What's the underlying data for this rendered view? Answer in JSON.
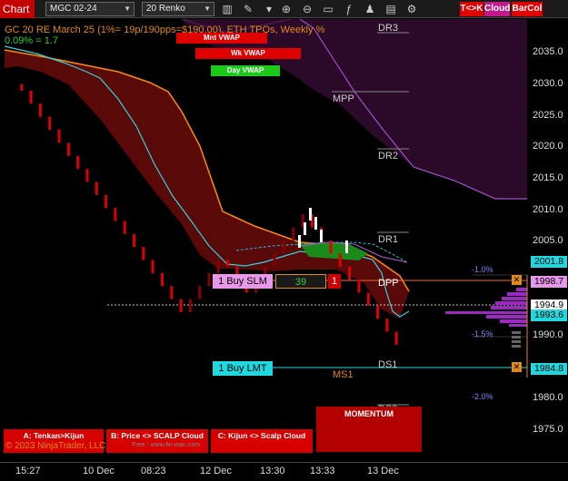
{
  "toolbar": {
    "title": "Chart",
    "instrument": "MGC 02-24",
    "bar_type": "20 Renko",
    "btn_tk": "T<>K",
    "btn_cloud": "Cloud",
    "btn_barcol": "BarCol",
    "colors": {
      "tk": "#e00000",
      "cloud": "#c2188a",
      "barcol": "#e00000"
    },
    "icons": [
      "bar-style-icon",
      "drawing-tool-icon",
      "zoom-in-icon",
      "zoom-out-icon",
      "data-box-icon",
      "indicators-icon",
      "strategies-icon",
      "properties-icon",
      "chart-trader-icon"
    ]
  },
  "chart": {
    "title": "GC 20 RE March 25 (1%= 19p/190pps=$190.00), ETH TPOs, Weekly %",
    "pct_readout": "0.09% = 1.7",
    "vwap_buttons": [
      {
        "label": "Mnt VWAP",
        "color": "#e00000"
      },
      {
        "label": "Wk VWAP",
        "color": "#e00000"
      },
      {
        "label": "Day VWAP",
        "color": "#1cc81c"
      }
    ],
    "levels": {
      "dr3": "DR3",
      "mpp": "MPP",
      "dr2": "DR2",
      "dr1": "DR1",
      "dpp": "DPP",
      "ds1": "DS1",
      "ms1": "MS1",
      "ds2": "DS2"
    },
    "pct_labels": [
      "-1.0%",
      "-1.5%",
      "-2.0%"
    ],
    "orders": {
      "buy_slm": {
        "label": "1 Buy SLM",
        "price": "1998.7",
        "qty": "39",
        "contracts": "1"
      },
      "buy_lmt": {
        "label": "1 Buy LMT",
        "price": "1984.8"
      }
    },
    "price_tags": {
      "level_2001": "2001.8",
      "last": "1994.9",
      "current": "1993.6"
    },
    "y_axis_labels": [
      "2035.0",
      "2030.0",
      "2025.0",
      "2020.0",
      "2015.0",
      "2010.0",
      "2005.0",
      "1990.0",
      "1980.0",
      "1975.0"
    ],
    "bottom_buttons": [
      {
        "label": "A: Tenkan>Kijun"
      },
      {
        "label": "B: Price <> SCALP Cloud"
      },
      {
        "label": "C: Kijun <> Scalp Cloud"
      }
    ],
    "momentum_label": "MOMENTUM",
    "copyright": "© 2023 NinjaTrader, LLC",
    "watermark": "Free - www.fin-wan.com",
    "time_labels": [
      "15:27",
      "10 Dec",
      "08:23",
      "12 Dec",
      "13:30",
      "13:33",
      "13 Dec"
    ]
  },
  "chart_data": {
    "type": "candlestick",
    "title": "GC 20 RE March 25 (1%= 19p/190pps=$190.00), ETH TPOs, Weekly %",
    "y_axis": {
      "min": 1972,
      "max": 2040,
      "ticks": [
        2035,
        2030,
        2025,
        2020,
        2015,
        2010,
        2005,
        1990,
        1980,
        1975
      ]
    },
    "bar_type": "20 Renko",
    "series": [
      {
        "name": "close",
        "values": [
          2030,
          2029,
          2027,
          2025,
          2023,
          2021,
          2019,
          2017,
          2015,
          2013,
          2011,
          2009,
          2007,
          2005,
          2003,
          2001,
          1999,
          1997,
          1995,
          1997,
          1999,
          2001,
          2003,
          2002,
          2000,
          1998,
          2000,
          2002,
          2004,
          2006,
          2008,
          2010,
          2008,
          2006,
          2004,
          2002,
          2000,
          1998,
          1996,
          1994,
          1992,
          1990
        ]
      }
    ],
    "price_levels": [
      {
        "label": "MPP",
        "value": 2029
      },
      {
        "label": "DR2",
        "value": 2020
      },
      {
        "label": "DR1",
        "value": 2006
      },
      {
        "label": "DPP",
        "value": 1998.7
      },
      {
        "label": "DS1",
        "value": 1984.8
      },
      {
        "label": "MS1",
        "value": 1983.8
      }
    ],
    "percent_levels": [
      {
        "label": "-1.0%",
        "value": 2000.4
      },
      {
        "label": "-1.5%",
        "value": 1990.3
      },
      {
        "label": "-2.0%",
        "value": 1980.5
      }
    ]
  }
}
